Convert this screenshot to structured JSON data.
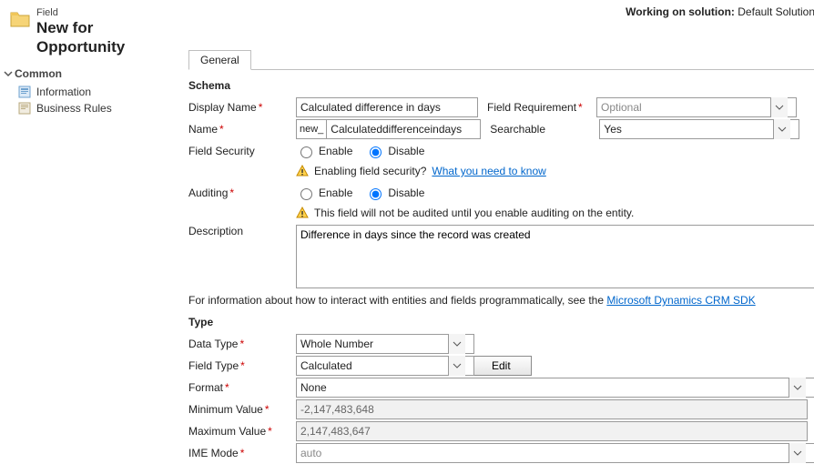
{
  "header": {
    "eyebrow": "Field",
    "title": "New for Opportunity",
    "solution_prefix": "Working on solution:",
    "solution_name": "Default Solution"
  },
  "nav": {
    "group": "Common",
    "items": [
      {
        "label": "Information"
      },
      {
        "label": "Business Rules"
      }
    ]
  },
  "tabs": {
    "general": "General"
  },
  "schema": {
    "heading": "Schema",
    "display_name_label": "Display Name",
    "display_name_value": "Calculated difference in days",
    "field_requirement_label": "Field Requirement",
    "field_requirement_value": "Optional",
    "name_label": "Name",
    "name_prefix": "new_",
    "name_value": "Calculateddifferenceindays",
    "searchable_label": "Searchable",
    "searchable_value": "Yes",
    "field_security_label": "Field Security",
    "enable_label": "Enable",
    "disable_label": "Disable",
    "security_msg": "Enabling field security?",
    "security_link": "What you need to know",
    "auditing_label": "Auditing",
    "auditing_msg": "This field will not be audited until you enable auditing on the entity.",
    "description_label": "Description",
    "description_value": "Difference in days since the record was created",
    "sdk_msg_prefix": "For information about how to interact with entities and fields programmatically, see the ",
    "sdk_link": "Microsoft Dynamics CRM SDK"
  },
  "type": {
    "heading": "Type",
    "data_type_label": "Data Type",
    "data_type_value": "Whole Number",
    "field_type_label": "Field Type",
    "field_type_value": "Calculated",
    "edit_label": "Edit",
    "format_label": "Format",
    "format_value": "None",
    "min_label": "Minimum Value",
    "min_value": "-2,147,483,648",
    "max_label": "Maximum Value",
    "max_value": "2,147,483,647",
    "ime_label": "IME Mode",
    "ime_value": "auto"
  }
}
